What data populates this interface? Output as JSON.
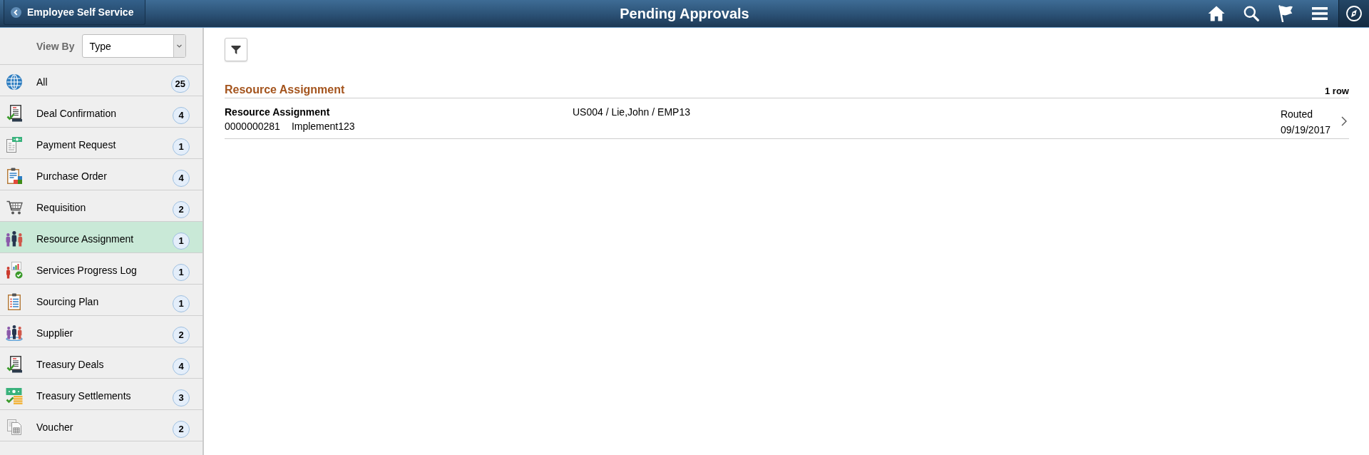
{
  "header": {
    "back_button": "Employee Self Service",
    "title": "Pending Approvals"
  },
  "sidebar": {
    "view_by": {
      "label": "View By",
      "value": "Type"
    },
    "items": [
      {
        "label": "All",
        "count": "25",
        "selected": false
      },
      {
        "label": "Deal Confirmation",
        "count": "4",
        "selected": false
      },
      {
        "label": "Payment Request",
        "count": "1",
        "selected": false
      },
      {
        "label": "Purchase Order",
        "count": "4",
        "selected": false
      },
      {
        "label": "Requisition",
        "count": "2",
        "selected": false
      },
      {
        "label": "Resource Assignment",
        "count": "1",
        "selected": true
      },
      {
        "label": "Services Progress Log",
        "count": "1",
        "selected": false
      },
      {
        "label": "Sourcing Plan",
        "count": "1",
        "selected": false
      },
      {
        "label": "Supplier",
        "count": "2",
        "selected": false
      },
      {
        "label": "Treasury Deals",
        "count": "4",
        "selected": false
      },
      {
        "label": "Treasury Settlements",
        "count": "3",
        "selected": false
      },
      {
        "label": "Voucher",
        "count": "2",
        "selected": false
      }
    ]
  },
  "content": {
    "section": {
      "title": "Resource Assignment",
      "row_count": "1 row",
      "rows": [
        {
          "title": "Resource Assignment",
          "number": "0000000281",
          "description": "Implement123",
          "assignee": "US004 / Lie,John / EMP13",
          "status": "Routed",
          "date": "09/19/2017"
        }
      ]
    }
  }
}
